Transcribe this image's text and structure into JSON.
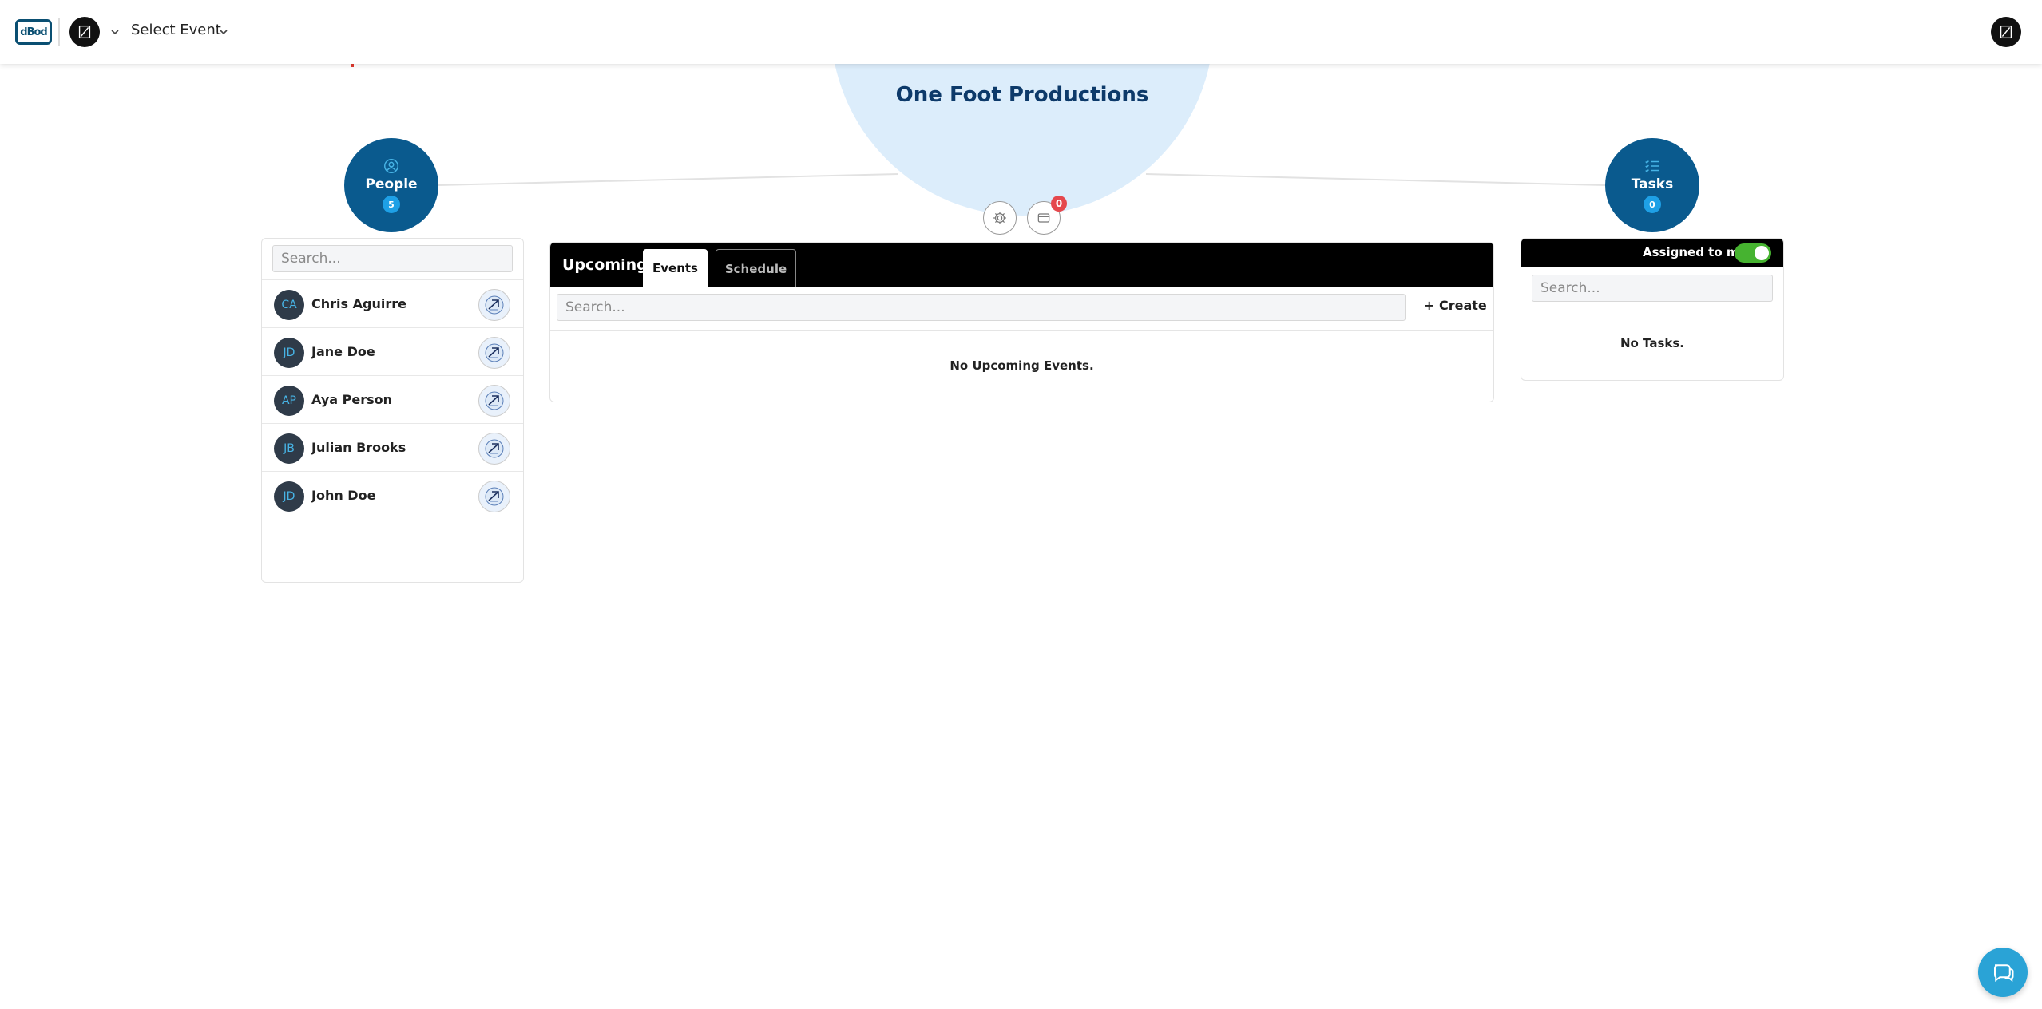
{
  "topbar": {
    "logo_text": "dBod",
    "select_event_label": "Select Event",
    "icons": [
      "org-avatar",
      "chevron-down-icon",
      "user-avatar"
    ]
  },
  "hub": {
    "org_name": "One Foot Productions",
    "notification_count": "0"
  },
  "people": {
    "label": "People",
    "count": "5",
    "search_placeholder": "Search...",
    "list": [
      {
        "initials": "CA",
        "name": "Chris Aguirre"
      },
      {
        "initials": "JD",
        "name": "Jane Doe"
      },
      {
        "initials": "AP",
        "name": "Aya Person"
      },
      {
        "initials": "JB",
        "name": "Julian Brooks"
      },
      {
        "initials": "JD",
        "name": "John Doe"
      }
    ]
  },
  "events": {
    "title": "Upcoming",
    "tabs": [
      "Events",
      "Schedule"
    ],
    "active_tab": "Events",
    "search_placeholder": "Search...",
    "create_label": "+ Create",
    "empty_message": "No Upcoming Events."
  },
  "tasks": {
    "label": "Tasks",
    "count": "0",
    "assigned_label": "Assigned to me",
    "assigned_on": true,
    "search_placeholder": "Search...",
    "empty_message": "No Tasks."
  },
  "colors": {
    "node_blue": "#0a5a8e",
    "count_badge": "#1ea0e6",
    "hub_bg": "#dcedfb",
    "toggle_on": "#46b330",
    "notification_red": "#e5484d",
    "chat_button": "#2aa3d6"
  }
}
